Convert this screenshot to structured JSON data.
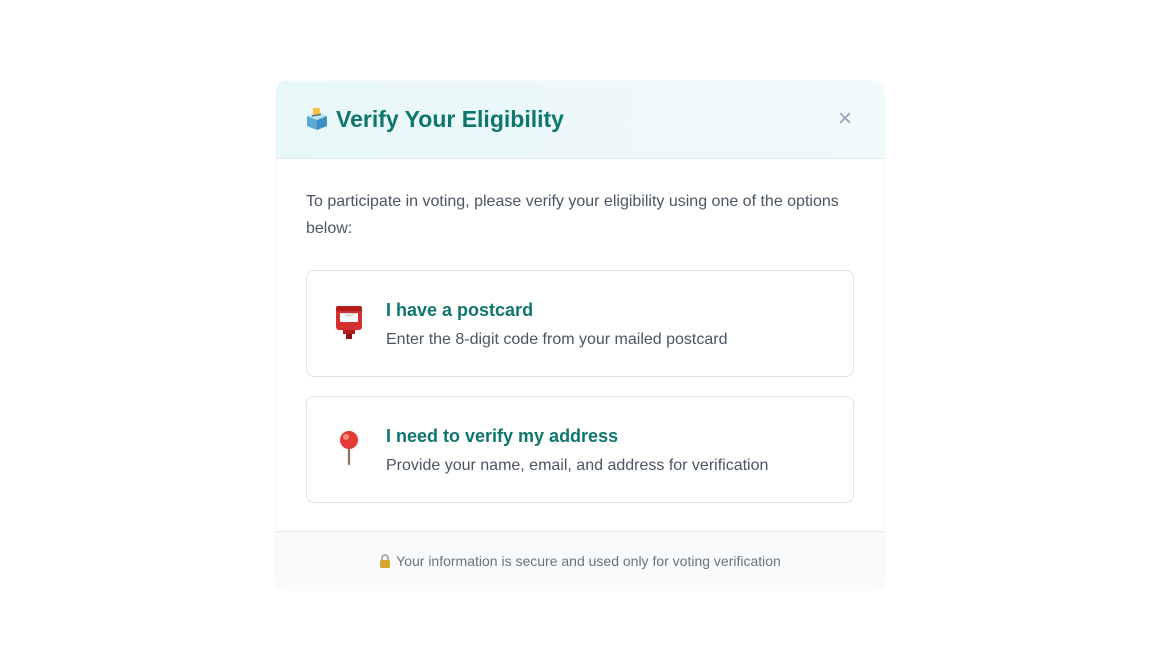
{
  "modal": {
    "title": "Verify Your Eligibility",
    "title_icon": "ballot-box-icon",
    "close_label": "×",
    "intro": "To participate in voting, please verify your eligibility using one of the options below:",
    "options": [
      {
        "icon": "postbox-icon",
        "title": "I have a postcard",
        "description": "Enter the 8-digit code from your mailed postcard"
      },
      {
        "icon": "round-pushpin-icon",
        "title": "I need to verify my address",
        "description": "Provide your name, email, and address for verification"
      }
    ],
    "footer": {
      "icon": "lock-icon",
      "text": "Your information is secure and used only for voting verification"
    }
  },
  "colors": {
    "accent": "#0f766e",
    "text": "#4b5563",
    "muted": "#6b7280",
    "close": "#94a3b8",
    "header_bg": "#e8f8f8",
    "footer_bg": "#f8fafc",
    "border": "#dde2e6"
  }
}
